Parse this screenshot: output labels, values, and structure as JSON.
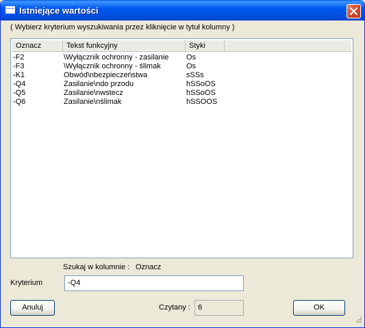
{
  "window": {
    "title": "Istniejące wartości"
  },
  "hint": "( Wybierz kryterium wyszukiwania przez kliknięcie w tytuł kolumny )",
  "table": {
    "columns": [
      "Oznacz",
      "Tekst funkcyjny",
      "Styki"
    ],
    "rows": [
      [
        "-F2",
        "\\Wyłącznik ochronny - zasilanie",
        "Os"
      ],
      [
        "-F3",
        "\\Wyłącznik ochronny - ślimak",
        "Os"
      ],
      [
        "-K1",
        "Obwód\\nbezpieczeństwa",
        "sSSs"
      ],
      [
        "-Q4",
        "Zasilanie\\ndo przodu",
        "hSSoOS"
      ],
      [
        "-Q5",
        "Zasilanie\\nwstecz",
        "hSSoOS"
      ],
      [
        "-Q6",
        "Zasilanie\\nślimak",
        "hSSOOS"
      ]
    ]
  },
  "search": {
    "label": "Szukaj w kolumnie :",
    "column": "Oznacz"
  },
  "criterion": {
    "label": "Kryterium",
    "value": "-Q4"
  },
  "buttons": {
    "cancel": "Anuluj",
    "ok": "OK"
  },
  "read": {
    "label": "Czytany :",
    "value": "6"
  }
}
